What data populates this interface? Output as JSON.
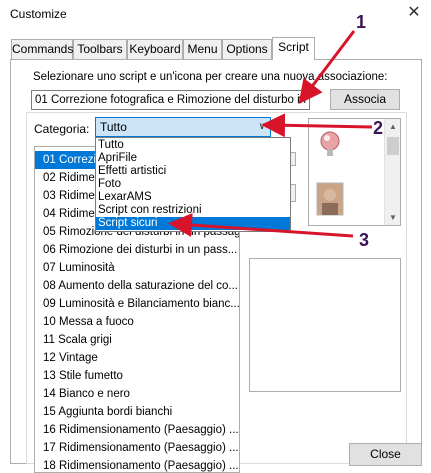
{
  "window": {
    "title": "Customize",
    "close_glyph": "✕"
  },
  "tabs": [
    {
      "label": "Commands",
      "active": false
    },
    {
      "label": "Toolbars",
      "active": false
    },
    {
      "label": "Keyboard",
      "active": false
    },
    {
      "label": "Menu",
      "active": false
    },
    {
      "label": "Options",
      "active": false
    },
    {
      "label": "Script",
      "active": true
    }
  ],
  "script_tab": {
    "prompt": "Selezionare uno script e un'icona per creare una nuova associazione:",
    "script_combo_value": "01 Correzione fotografica e Rimozione del disturbo in ...",
    "associate_button": "Associa",
    "category_label": "Categoria:",
    "category_value": "Tutto",
    "category_options": [
      "Tutto",
      "ApriFile",
      "Effetti artistici",
      "Foto",
      "LexarAMS",
      "Script con restrizioni",
      "Script sicuri"
    ],
    "category_hovered_index": 6,
    "script_list": [
      "01 Correzione fotografica e Rimozione del disturbo",
      "02 Ridimensionamento (Paesaggio)",
      "03 Ridimensionamento (Paesaggio)",
      "04 Ridimensionamento (Paesaggio)",
      "05 Rimozione dei disturbi in un passaggio",
      "06  Rimozione dei disturbi in un pass...",
      "07 Luminosità",
      "08 Aumento della saturazione del co...",
      "09 Luminosità e Bilanciamento bianc...",
      "10 Messa a fuoco",
      "11 Scala grigi",
      "12 Vintage",
      "13 Stile fumetto",
      "14 Bianco e nero",
      "15 Aggiunta bordi bianchi",
      "16 Ridimensionamento (Paesaggio) ...",
      "17 Ridimensionamento (Paesaggio) ...",
      "18 Ridimensionamento (Paesaggio) ..."
    ],
    "script_selected_index": 0,
    "close_button": "Close"
  },
  "annotations": {
    "callout_1": "1",
    "callout_2": "2",
    "callout_3": "3",
    "color": "#d8142a",
    "number_color": "#3a1456"
  },
  "icons": {
    "combo_arrow": "chevron-down-icon",
    "lightbulb": "lightbulb-icon",
    "person": "person-photo-icon"
  }
}
